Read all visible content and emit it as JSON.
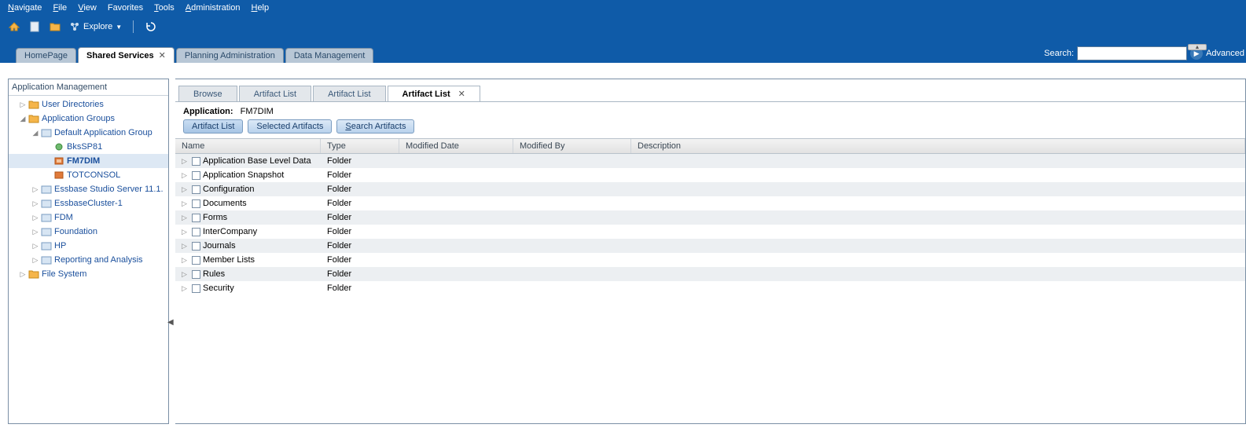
{
  "menu": {
    "navigate": "Navigate",
    "file": "File",
    "view": "View",
    "favorites": "Favorites",
    "tools": "Tools",
    "administration": "Administration",
    "help": "Help"
  },
  "toolbar": {
    "explore": "Explore"
  },
  "tabs": [
    {
      "label": "HomePage",
      "closable": false,
      "active": false
    },
    {
      "label": "Shared Services",
      "closable": true,
      "active": true
    },
    {
      "label": "Planning Administration",
      "closable": false,
      "active": false
    },
    {
      "label": "Data Management",
      "closable": false,
      "active": false
    }
  ],
  "search": {
    "label": "Search:",
    "value": "",
    "advanced": "Advanced"
  },
  "sidebar": {
    "title": "Application Management",
    "tree": [
      {
        "label": "User Directories",
        "level": 1,
        "expandable": true
      },
      {
        "label": "Application Groups",
        "level": 1,
        "expanded": true
      },
      {
        "label": "Default Application Group",
        "level": 2,
        "expanded": true
      },
      {
        "label": "BksSP81",
        "level": 3
      },
      {
        "label": "FM7DIM",
        "level": 3,
        "selected": true
      },
      {
        "label": "TOTCONSOL",
        "level": 3
      },
      {
        "label": "Essbase Studio Server 11.1.",
        "level": 2,
        "expandable": true
      },
      {
        "label": "EssbaseCluster-1",
        "level": 2,
        "expandable": true
      },
      {
        "label": "FDM",
        "level": 2,
        "expandable": true
      },
      {
        "label": "Foundation",
        "level": 2,
        "expandable": true
      },
      {
        "label": "HP",
        "level": 2,
        "expandable": true
      },
      {
        "label": "Reporting and Analysis",
        "level": 2,
        "expandable": true
      },
      {
        "label": "File System",
        "level": 1,
        "expandable": true
      }
    ]
  },
  "inner_tabs": [
    {
      "label": "Browse",
      "active": false
    },
    {
      "label": "Artifact List",
      "active": false
    },
    {
      "label": "Artifact List",
      "active": false
    },
    {
      "label": "Artifact List",
      "active": true,
      "closable": true
    }
  ],
  "context": {
    "label": "Application:",
    "value": "FM7DIM"
  },
  "buttons": {
    "artifact_list": "Artifact List",
    "selected_artifacts": "Selected Artifacts",
    "search_artifacts": "Search Artifacts"
  },
  "grid": {
    "columns": {
      "name": "Name",
      "type": "Type",
      "modified_date": "Modified Date",
      "modified_by": "Modified By",
      "description": "Description"
    },
    "rows": [
      {
        "name": "Application Base Level Data",
        "type": "Folder"
      },
      {
        "name": "Application Snapshot",
        "type": "Folder"
      },
      {
        "name": "Configuration",
        "type": "Folder"
      },
      {
        "name": "Documents",
        "type": "Folder"
      },
      {
        "name": "Forms",
        "type": "Folder"
      },
      {
        "name": "InterCompany",
        "type": "Folder"
      },
      {
        "name": "Journals",
        "type": "Folder"
      },
      {
        "name": "Member Lists",
        "type": "Folder"
      },
      {
        "name": "Rules",
        "type": "Folder"
      },
      {
        "name": "Security",
        "type": "Folder"
      }
    ]
  }
}
